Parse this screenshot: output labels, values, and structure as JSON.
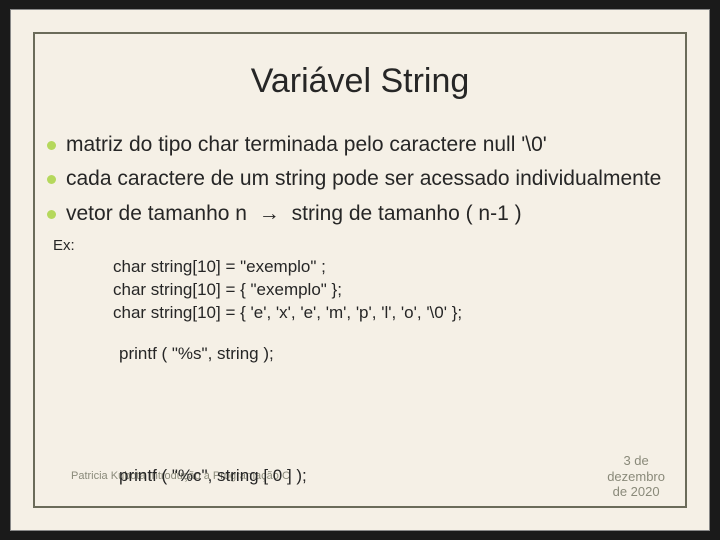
{
  "title": "Variável String",
  "bullets": {
    "b1": "matriz do tipo char terminada pelo caractere null '\\0'",
    "b2": "cada caractere de um string pode ser acessado individualmente",
    "b3a": "vetor de tamanho n",
    "b3arrow": "→",
    "b3b": "string de tamanho ( n-1 )"
  },
  "ex": {
    "label": "Ex:",
    "line1": "char  string[10]  =  \"exemplo\" ;",
    "line2": "char  string[10] = { \"exemplo\" };",
    "line3": "char  string[10]  = { 'e', 'x', 'e', 'm', 'p', 'l', 'o', '\\0' };"
  },
  "printf": {
    "p1": "printf ( \"%s\", string );",
    "p2": "printf (  \"%c\",  string [ 0 ] );"
  },
  "footer": "Patricia Kubota     Introdução à Programação C",
  "date": {
    "l1": "3 de",
    "l2": "dezembro",
    "l3": "de 2020"
  }
}
